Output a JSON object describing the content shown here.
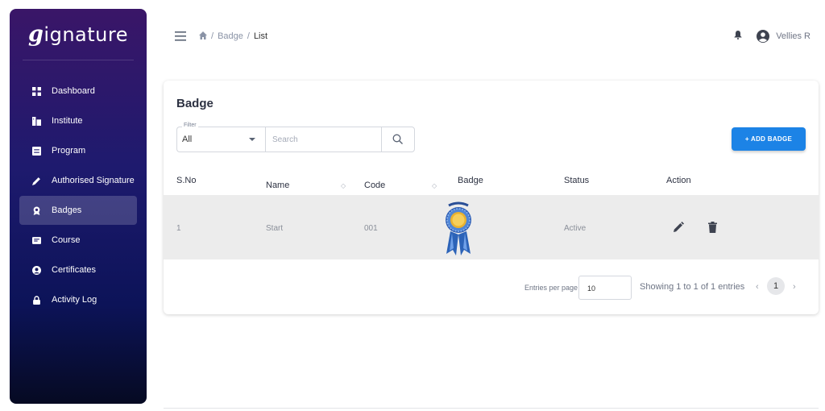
{
  "sidebar": {
    "logo_first": "g",
    "logo_rest": "ignature",
    "items": [
      {
        "label": "Dashboard",
        "icon": "dashboard-icon"
      },
      {
        "label": "Institute",
        "icon": "institute-icon"
      },
      {
        "label": "Program",
        "icon": "program-icon"
      },
      {
        "label": "Authorised Signature",
        "icon": "pen-icon"
      },
      {
        "label": "Badges",
        "icon": "badge-icon",
        "active": true
      },
      {
        "label": "Course",
        "icon": "course-icon"
      },
      {
        "label": "Certificates",
        "icon": "certificate-icon"
      },
      {
        "label": "Activity Log",
        "icon": "lock-icon"
      }
    ]
  },
  "topbar": {
    "breadcrumb": [
      "Badge",
      "List"
    ],
    "user_name": "Vellies R"
  },
  "card": {
    "title": "Badge",
    "filter_label": "Filter",
    "filter_value": "All",
    "search_placeholder": "Search",
    "add_button": "+ ADD BADGE"
  },
  "table": {
    "columns": [
      "S.No",
      "Name",
      "Code",
      "Badge",
      "Status",
      "Action"
    ],
    "rows": [
      {
        "sno": "1",
        "name": "Start",
        "code": "001",
        "status": "Active"
      }
    ]
  },
  "pagination": {
    "entries_label": "Entries per page",
    "entries_value": "10",
    "showing": "Showing 1 to 1 of 1 entries",
    "prev": "‹",
    "current": "1",
    "next": "›"
  },
  "colors": {
    "accent": "#1c83e6",
    "sidebar_top": "#3a1668",
    "sidebar_bottom": "#060a22",
    "row_bg": "#ececec"
  }
}
